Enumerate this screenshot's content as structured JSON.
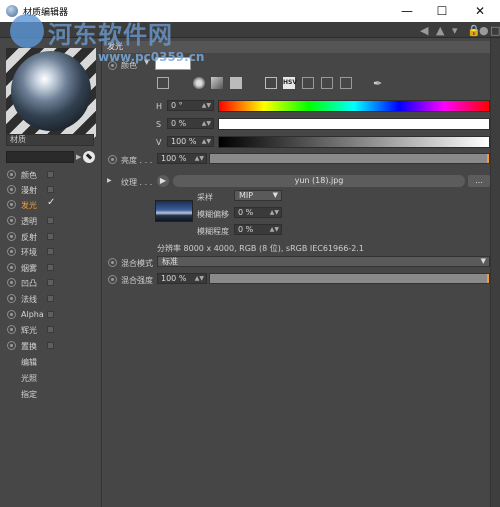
{
  "window": {
    "title": "材质编辑器",
    "minimize": "—",
    "maximize": "☐",
    "close": "✕"
  },
  "watermark": {
    "text": "河东软件网",
    "url": "www.pc0359.cn"
  },
  "material": {
    "name": "材质"
  },
  "channels": [
    {
      "label": "颜色",
      "checked": false
    },
    {
      "label": "漫射",
      "checked": false
    },
    {
      "label": "发光",
      "checked": true
    },
    {
      "label": "透明",
      "checked": false
    },
    {
      "label": "反射",
      "checked": false
    },
    {
      "label": "环境",
      "checked": false
    },
    {
      "label": "烟雾",
      "checked": false
    },
    {
      "label": "凹凸",
      "checked": false
    },
    {
      "label": "法线",
      "checked": false
    },
    {
      "label": "Alpha",
      "checked": false
    },
    {
      "label": "辉光",
      "checked": false
    },
    {
      "label": "置换",
      "checked": false
    }
  ],
  "extra_items": [
    "编辑",
    "光照",
    "指定"
  ],
  "section": {
    "title": "发光"
  },
  "color": {
    "label": "颜色",
    "value_hex": "#ffffff"
  },
  "hsv": {
    "h_label": "H",
    "h_value": "0 °",
    "s_label": "S",
    "s_value": "0 %",
    "v_label": "V",
    "v_value": "100 %",
    "mode_label": "HSV"
  },
  "brightness": {
    "label": "亮度 . . .",
    "value": "100 %",
    "fraction": 1.0
  },
  "texture": {
    "label": "纹理 . . .",
    "file": "yun (18).jpg",
    "more_button": "...",
    "sampling_label": "采样",
    "sampling_value": "MIP",
    "blur_offset_label": "模糊偏移",
    "blur_offset_value": "0 %",
    "blur_scale_label": "模糊程度",
    "blur_scale_value": "0 %",
    "resolution": "分辨率 8000 x 4000, RGB (8 位), sRGB IEC61966-2.1"
  },
  "mix_mode": {
    "label": "混合模式",
    "value": "标准"
  },
  "mix_strength": {
    "label": "混合强度",
    "value": "100 %",
    "fraction": 1.0
  }
}
